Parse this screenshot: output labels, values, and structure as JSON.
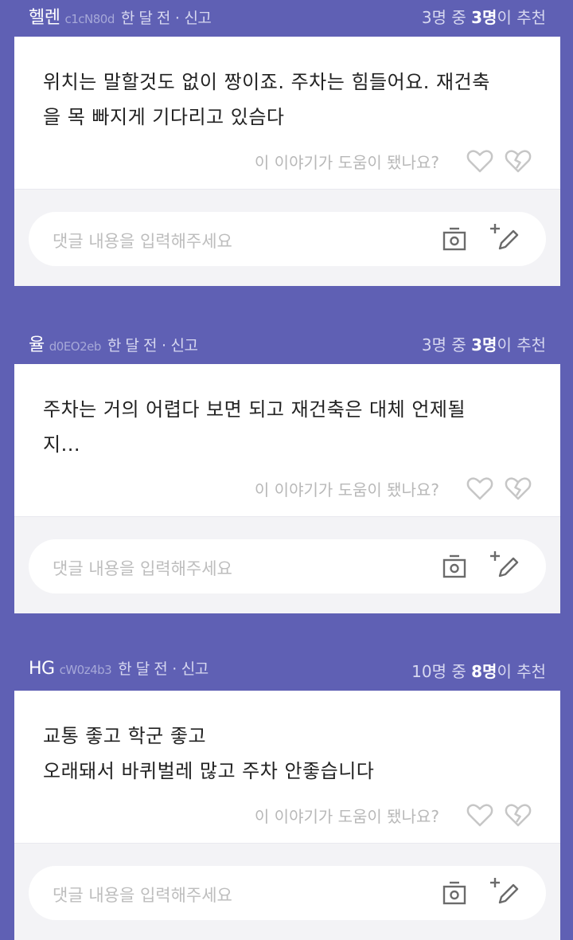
{
  "reviews": [
    {
      "nickname": "헬렌",
      "user_id": "c1cN80d",
      "time": "한 달 전",
      "report": "신고",
      "rec_prefix": "3명 중 ",
      "rec_highlight": "3명",
      "rec_suffix": "이 추천",
      "text": "위치는 말할것도 없이 짱이죠. 주차는 힘들어요. 재건축\n을 목 빠지게 기다리고 있슴다",
      "helpful_label": "이 이야기가 도움이 됐나요?",
      "comment_placeholder": "댓글 내용을 입력해주세요"
    },
    {
      "nickname": "율",
      "user_id": "d0EO2eb",
      "time": "한 달 전",
      "report": "신고",
      "rec_prefix": "3명 중 ",
      "rec_highlight": "3명",
      "rec_suffix": "이 추천",
      "text": "주차는 거의 어렵다 보면 되고 재건축은 대체 언제될\n지...",
      "helpful_label": "이 이야기가 도움이 됐나요?",
      "comment_placeholder": "댓글 내용을 입력해주세요"
    },
    {
      "nickname": "HG",
      "user_id": "cW0z4b3",
      "time": "한 달 전",
      "report": "신고",
      "rec_prefix": "10명 중 ",
      "rec_highlight": "8명",
      "rec_suffix": "이 추천",
      "text": "교통 좋고 학군 좋고\n오래돼서 바퀴벌레 많고 주차 안좋습니다",
      "helpful_label": "이 이야기가 도움이 됐나요?",
      "comment_placeholder": "댓글 내용을 입력해주세요"
    }
  ],
  "icons": {
    "like": "heart-outline-icon",
    "unlike": "broken-heart-icon",
    "photo": "camera-icon",
    "write": "write-pencil-icon"
  },
  "colors": {
    "background": "#5f60b4",
    "card": "#ffffff",
    "comment_area": "#f3f3f6"
  }
}
